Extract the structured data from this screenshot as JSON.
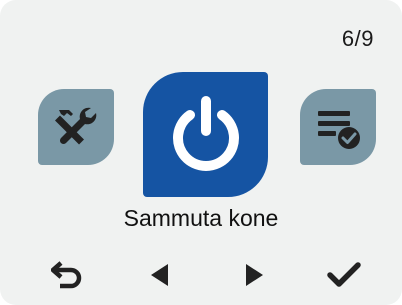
{
  "header": {
    "page_indicator": "6/9"
  },
  "carousel": {
    "left_tile_icon": "tools-icon",
    "center_tile_icon": "power-icon",
    "right_tile_icon": "list-check-icon",
    "selected_label": "Sammuta kone"
  },
  "nav": {
    "back_icon": "back-arrow-icon",
    "prev_icon": "triangle-left-icon",
    "next_icon": "triangle-right-icon",
    "confirm_icon": "checkmark-icon"
  },
  "colors": {
    "background": "#f0f2f1",
    "selected_tile": "#1554a3",
    "side_tile": "#7a98a6",
    "icon_dark": "#222222"
  }
}
